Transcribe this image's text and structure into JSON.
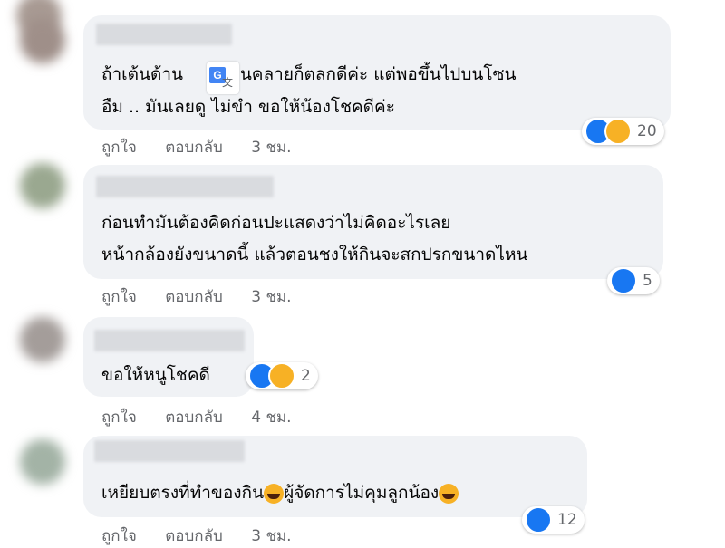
{
  "comments": [
    {
      "text_lines": [
        "ถ้าเต้นด้าน",
        "อ่อนคลายก็ตลกดีค่ะ แต่พอขึ้นไปบนโซน",
        "อืม .. มันเลยดู",
        "ไม่ขำ ขอให้น้องโชคดีค่ะ"
      ],
      "reaction_count": "20",
      "like_label": "ถูกใจ",
      "reply_label": "ตอบกลับ",
      "time": "3 ชม."
    },
    {
      "text_lines": [
        "ก่อนทำมันต้องคิดก่อนปะแสดงว่าไม่คิดอะไรเลย",
        "หน้ากล้องยังขนาดนี้ แล้วตอนชงให้กินจะสกปรกขนาดไหน"
      ],
      "reaction_count": "5",
      "like_label": "ถูกใจ",
      "reply_label": "ตอบกลับ",
      "time": "3 ชม."
    },
    {
      "text_lines": [
        "ขอให้หนูโชคดี"
      ],
      "reaction_count": "2",
      "like_label": "ถูกใจ",
      "reply_label": "ตอบกลับ",
      "time": "4 ชม."
    },
    {
      "text_lines": [
        "เหยียบตรงที่ทำของกิน",
        "ผู้จัดการไม่คุมลูกน้อง"
      ],
      "reaction_count": "12",
      "like_label": "ถูกใจ",
      "reply_label": "ตอบกลับ",
      "time": "3 ชม."
    }
  ],
  "translate_icon": "google-translate-icon",
  "colors": {
    "bubble": "#f0f2f5",
    "like": "#1877f2",
    "haha": "#f7b125",
    "meta": "#65676b"
  }
}
